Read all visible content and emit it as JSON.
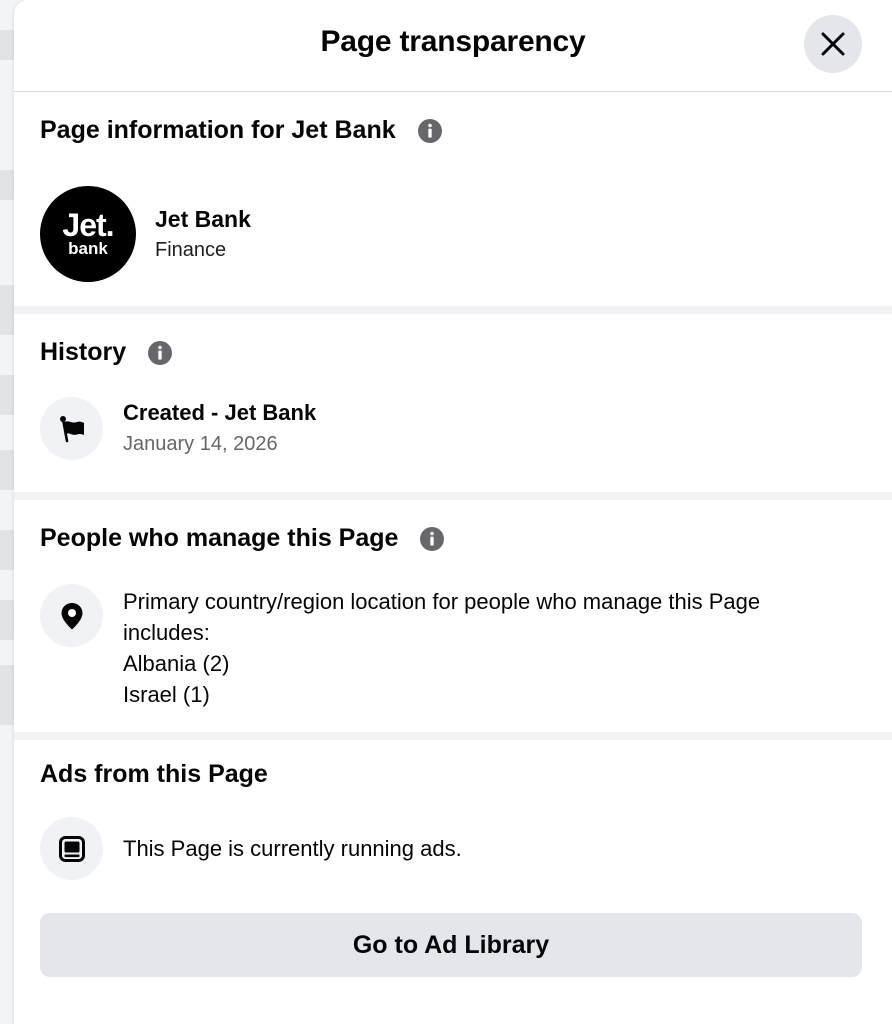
{
  "header": {
    "title": "Page transparency",
    "close_icon": "close-icon"
  },
  "page_info": {
    "title": "Page information for Jet Bank",
    "info_icon": "info-icon",
    "avatar": {
      "main": "Jet.",
      "sub": "bank"
    },
    "name": "Jet Bank",
    "category": "Finance"
  },
  "history": {
    "title": "History",
    "info_icon": "info-icon",
    "item_icon": "flag-icon",
    "event": "Created - Jet Bank",
    "date": "January 14, 2026"
  },
  "managers": {
    "title": "People who manage this Page",
    "info_icon": "info-icon",
    "item_icon": "location-pin-icon",
    "description_line1": "Primary country/region location for people who manage this Page",
    "description_line2": "includes:",
    "countries": [
      "Albania (2)",
      "Israel (1)"
    ]
  },
  "ads": {
    "title": "Ads from this Page",
    "item_icon": "ad-screen-icon",
    "status": "This Page is currently running ads.",
    "button_label": "Go to Ad Library"
  },
  "colors": {
    "surface": "#ffffff",
    "divider": "#f0f2f5",
    "button_bg": "#e4e6eb",
    "text_primary": "#050505",
    "text_secondary": "#65676b"
  }
}
